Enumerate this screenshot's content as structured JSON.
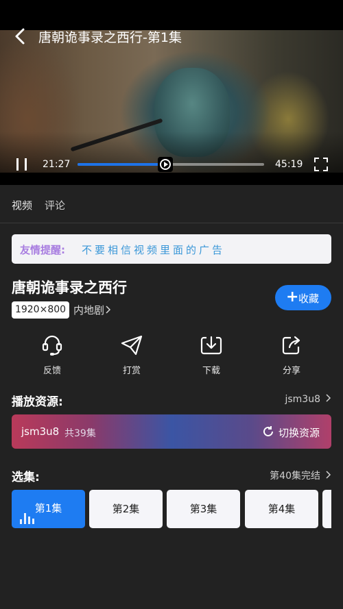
{
  "player": {
    "title": "唐朝诡事录之西行-第1集",
    "current_time": "21:27",
    "total_time": "45:19",
    "progress": 0.47
  },
  "tabs": [
    {
      "label": "视频"
    },
    {
      "label": "评论"
    }
  ],
  "notice": {
    "label": "友情提醒:",
    "message": "不要相信视频里面的广告"
  },
  "show": {
    "title": "唐朝诡事录之西行",
    "resolution": "1920×800",
    "genre": "内地剧",
    "favorite_label": "收藏"
  },
  "actions": [
    {
      "label": "反馈",
      "icon": "headset-icon"
    },
    {
      "label": "打赏",
      "icon": "paper-plane-icon"
    },
    {
      "label": "下载",
      "icon": "download-icon"
    },
    {
      "label": "分享",
      "icon": "share-icon"
    }
  ],
  "source_section": {
    "title": "播放资源:",
    "current": "jsm3u8",
    "bar_name": "jsm3u8",
    "bar_count": "共39集",
    "switch_label": "切换资源"
  },
  "episode_section": {
    "title": "选集:",
    "status": "第40集完结",
    "episodes": [
      "第1集",
      "第2集",
      "第3集",
      "第4集"
    ]
  },
  "colors": {
    "accent": "#1e7cf2",
    "background": "#222222",
    "notice_label": "#a87de0",
    "notice_message": "#3a97d8"
  }
}
